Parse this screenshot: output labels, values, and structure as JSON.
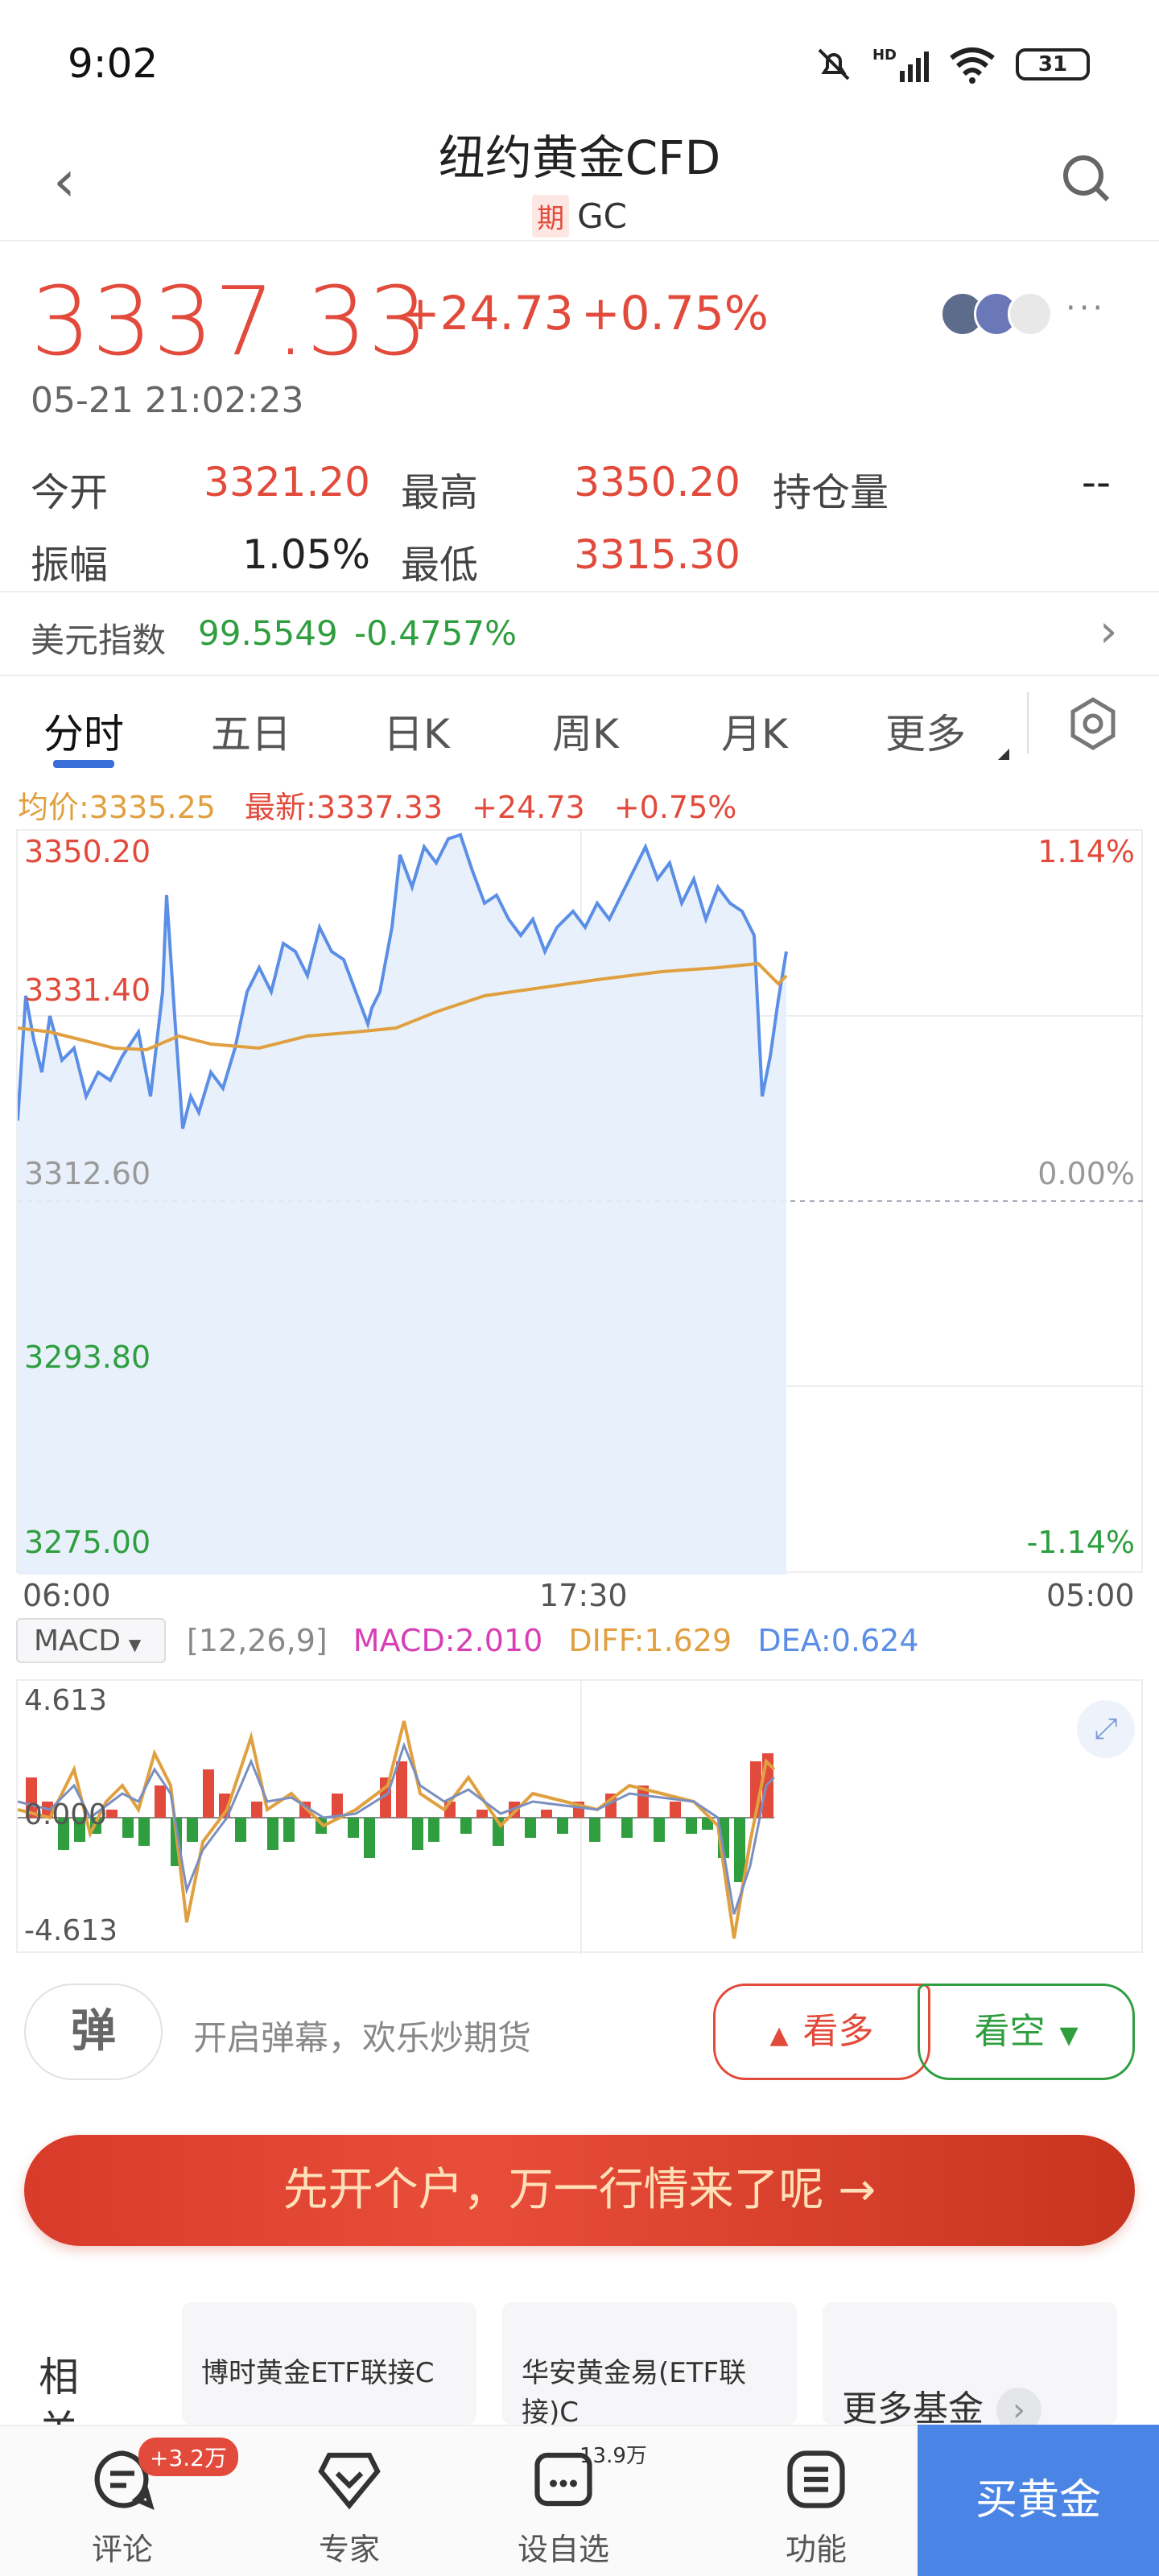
{
  "status_bar": {
    "time": "9:02",
    "battery": "31",
    "network": "HD"
  },
  "header": {
    "title": "纽约黄金CFD",
    "tag": "期",
    "code": "GC"
  },
  "quote": {
    "price": "3337.33",
    "change": "+24.73",
    "change_pct": "+0.75%",
    "timestamp": "05-21 21:02:23"
  },
  "stats": {
    "open_label": "今开",
    "open_value": "3321.20",
    "high_label": "最高",
    "high_value": "3350.20",
    "oi_label": "持仓量",
    "oi_value": "--",
    "amp_label": "振幅",
    "amp_value": "1.05%",
    "low_label": "最低",
    "low_value": "3315.30"
  },
  "index": {
    "label": "美元指数",
    "value": "99.5549",
    "change": "-0.4757%"
  },
  "tabs": [
    "分时",
    "五日",
    "日K",
    "周K",
    "月K",
    "更多"
  ],
  "legend": {
    "avg": "均价:3335.25",
    "latest": "最新:3337.33",
    "change": "+24.73",
    "pct": "+0.75%"
  },
  "chart_axes": {
    "y_left": [
      "3350.20",
      "3331.40",
      "3312.60",
      "3293.80",
      "3275.00"
    ],
    "y_right": [
      "1.14%",
      "0.00%",
      "-1.14%"
    ],
    "x": [
      "06:00",
      "17:30",
      "05:00"
    ]
  },
  "macd": {
    "selector": "MACD",
    "params": "[12,26,9]",
    "macd": "MACD:2.010",
    "diff": "DIFF:1.629",
    "dea": "DEA:0.624",
    "y_top": "4.613",
    "y_mid": "0.000",
    "y_bot": "-4.613"
  },
  "danmaku": {
    "icon": "弹",
    "placeholder": "开启弹幕，欢乐炒期货"
  },
  "bull_bear": {
    "bull": "看多",
    "bear": "看空"
  },
  "cta": {
    "text": "先开个户，万一行情来了呢 →"
  },
  "funds": {
    "section_label": "相关基金",
    "items": [
      "博时黄金ETF联接C",
      "华安黄金易(ETF联接)C"
    ],
    "more": "更多基金"
  },
  "bottom_nav": {
    "comment": "评论",
    "comment_badge": "+3.2万",
    "expert": "专家",
    "watchlist": "设自选",
    "watchlist_count": "13.9万",
    "functions": "功能",
    "buy": "买黄金"
  },
  "colors": {
    "up": "#e24a3b",
    "down": "#2e9e3f",
    "price_line": "#5b8ee6",
    "avg_line": "#e0a040",
    "accent": "#4a84e4"
  }
}
